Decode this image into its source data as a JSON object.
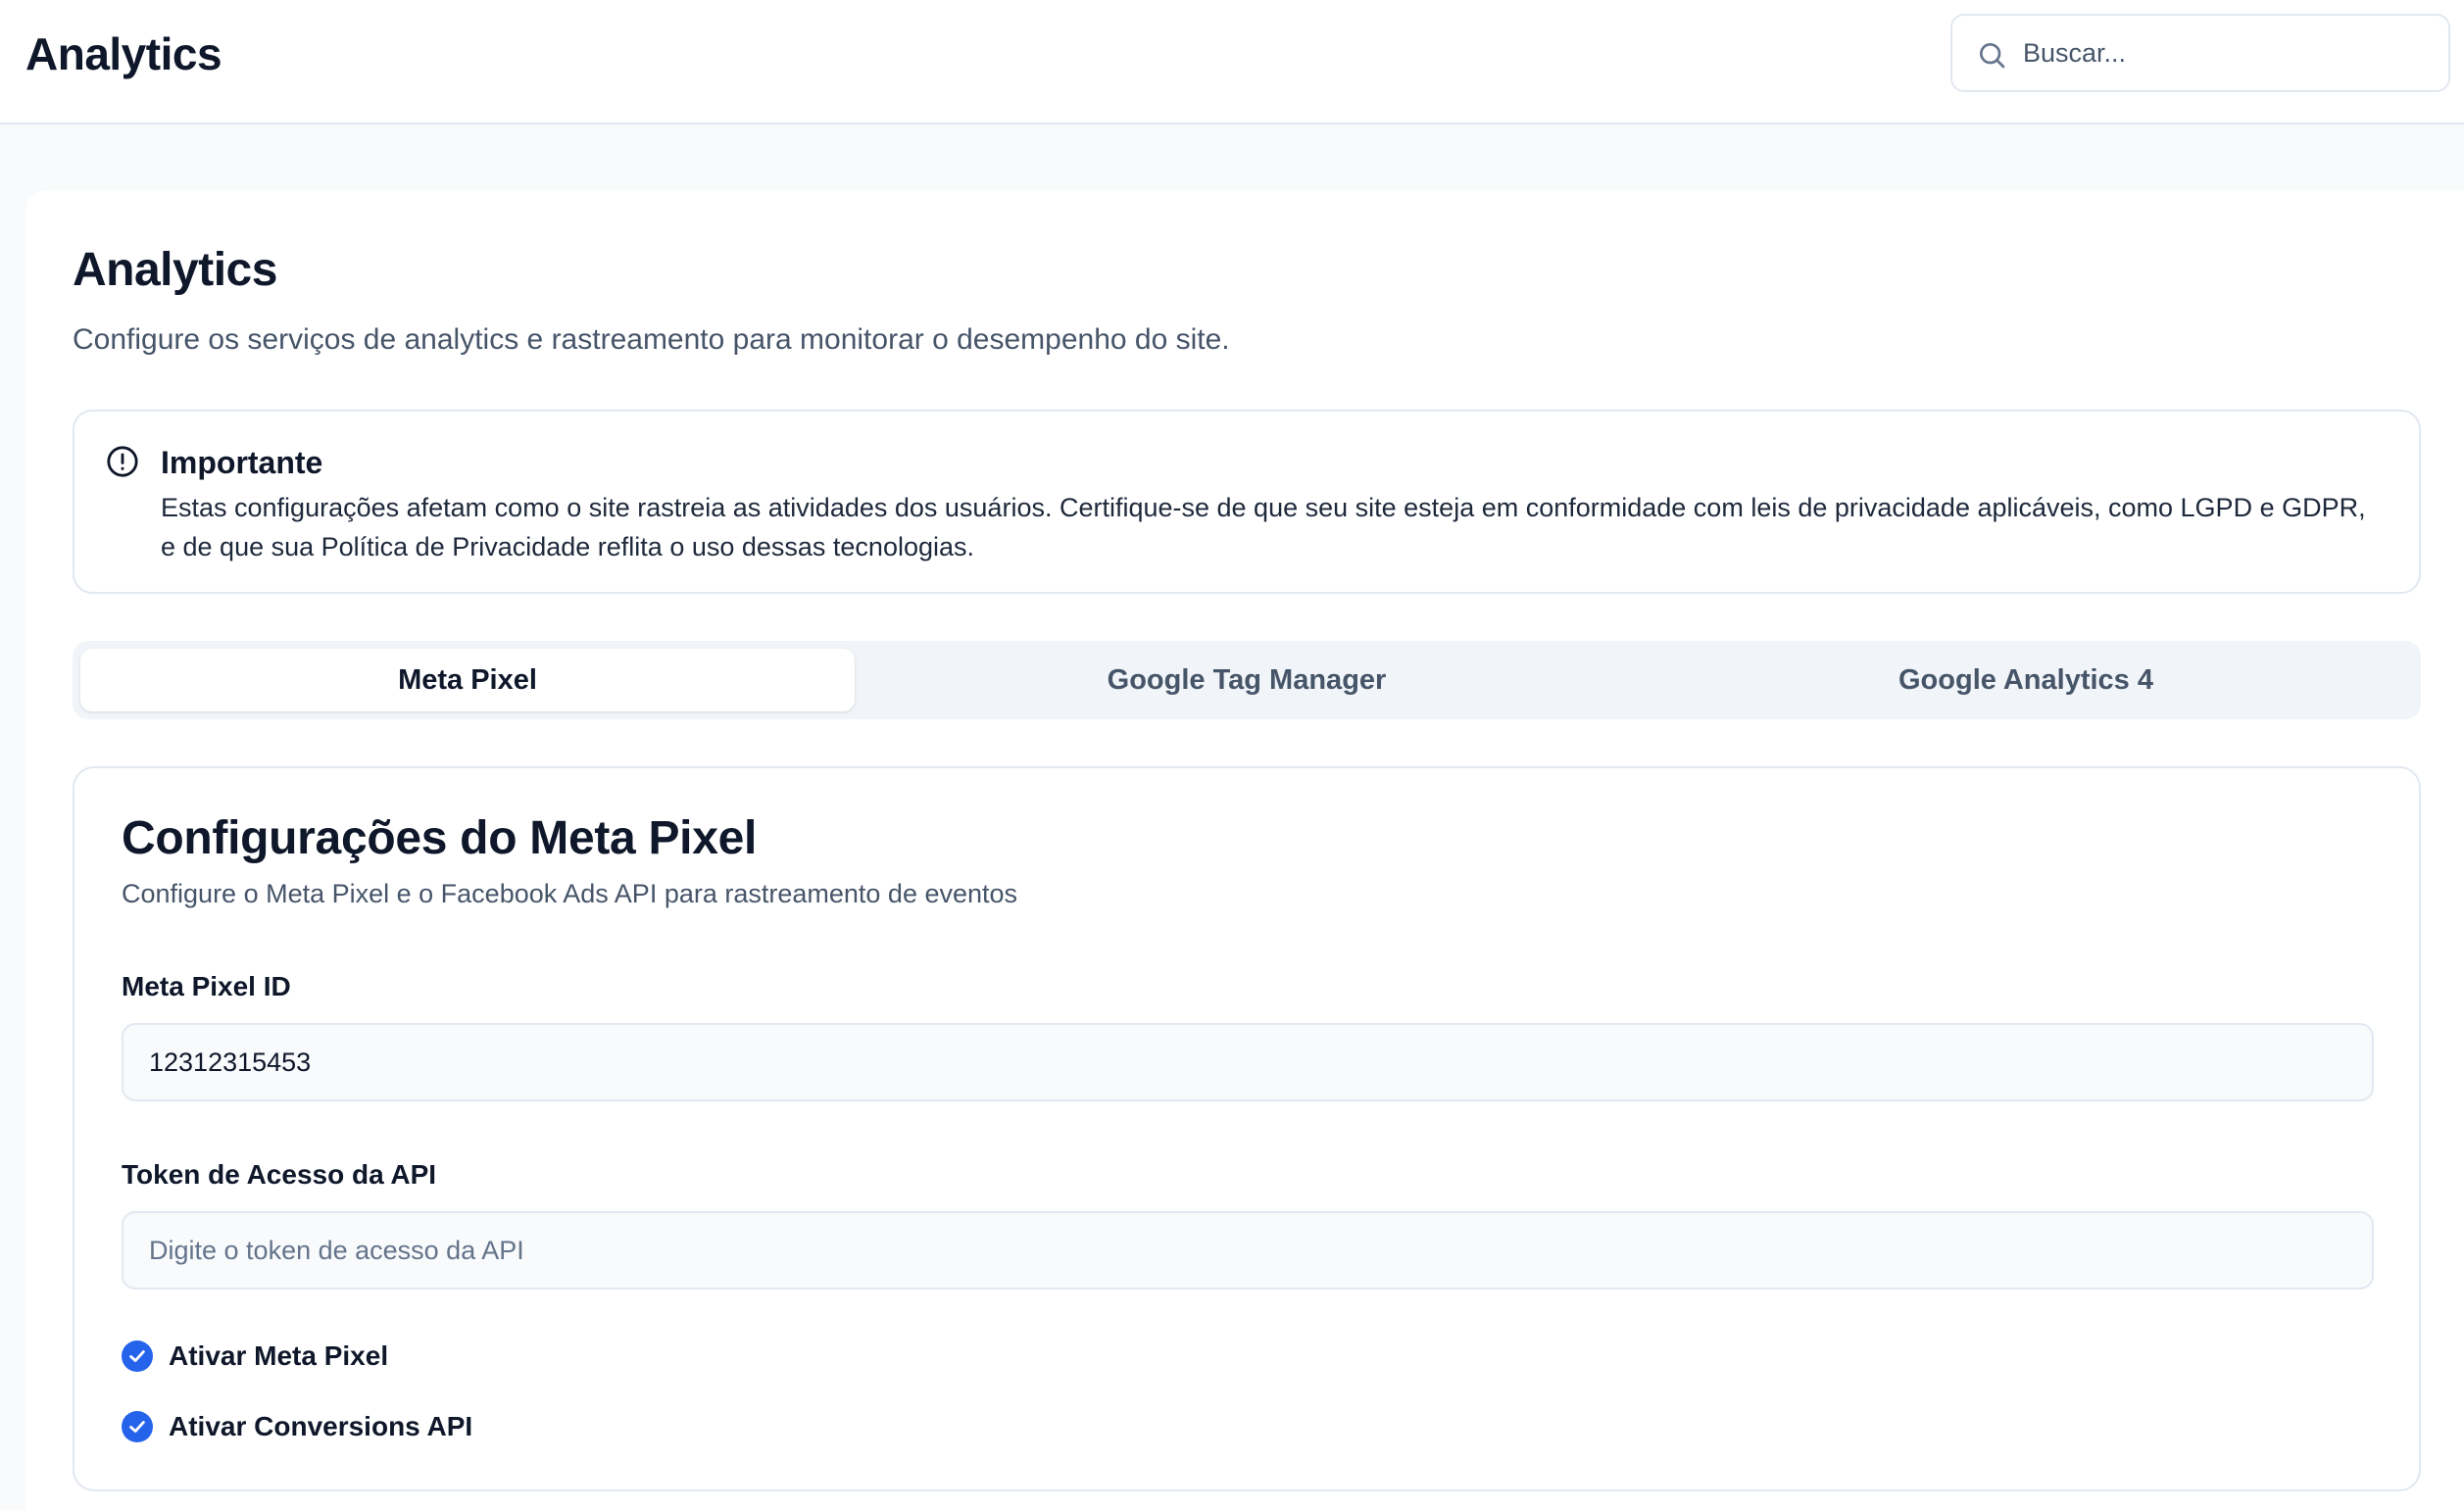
{
  "header": {
    "title": "Analytics",
    "search_placeholder": "Buscar..."
  },
  "page": {
    "title": "Analytics",
    "subtitle": "Configure os serviços de analytics e rastreamento para monitorar o desempenho do site."
  },
  "alert": {
    "icon": "alert-circle-icon",
    "title": "Importante",
    "text": "Estas configurações afetam como o site rastreia as atividades dos usuários. Certifique-se de que seu site esteja em conformidade com leis de privacidade aplicáveis, como LGPD e GDPR, e de que sua Política de Privacidade reflita o uso dessas tecnologias."
  },
  "tabs": [
    {
      "label": "Meta Pixel",
      "active": true
    },
    {
      "label": "Google Tag Manager",
      "active": false
    },
    {
      "label": "Google Analytics 4",
      "active": false
    }
  ],
  "meta_pixel": {
    "title": "Configurações do Meta Pixel",
    "description": "Configure o Meta Pixel e o Facebook Ads API para rastreamento de eventos",
    "pixel_id": {
      "label": "Meta Pixel ID",
      "value": "12312315453"
    },
    "api_token": {
      "label": "Token de Acesso da API",
      "value": "",
      "placeholder": "Digite o token de acesso da API"
    },
    "checkboxes": [
      {
        "label": "Ativar Meta Pixel",
        "checked": true
      },
      {
        "label": "Ativar Conversions API",
        "checked": true
      }
    ]
  },
  "colors": {
    "accent": "#2563eb",
    "text": "#0f172a",
    "muted": "#475569",
    "border": "#e2e8f0"
  }
}
